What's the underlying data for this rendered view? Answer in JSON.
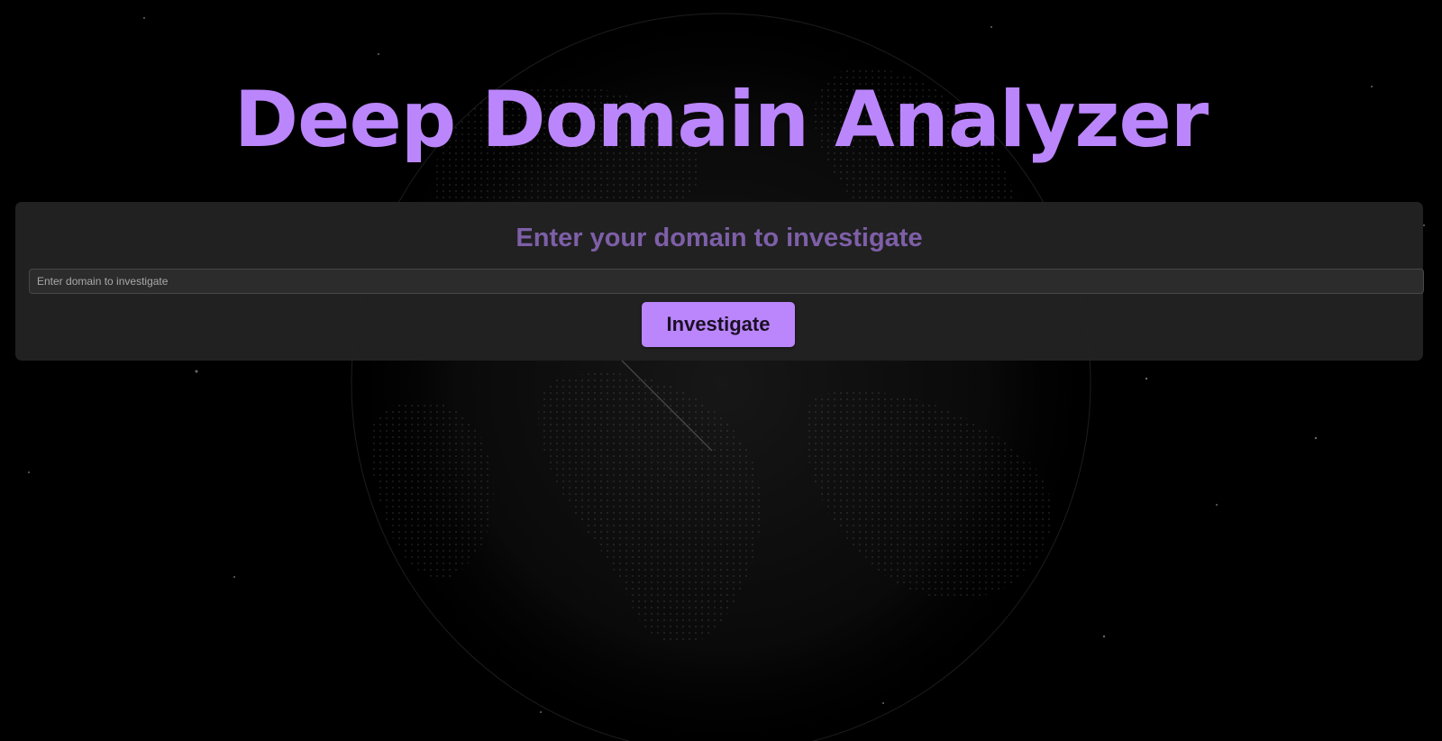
{
  "app": {
    "title": "Deep Domain Analyzer"
  },
  "form": {
    "heading": "Enter your domain to investigate",
    "input_placeholder": "Enter domain to investigate",
    "input_value": "",
    "submit_label": "Investigate"
  },
  "background": {
    "icon": "globe-dots-icon"
  },
  "colors": {
    "accent": "#bb86fc",
    "heading_muted": "#7e5fa8",
    "button_text": "#1a1024",
    "panel": "#222222",
    "page_background": "#000000"
  }
}
